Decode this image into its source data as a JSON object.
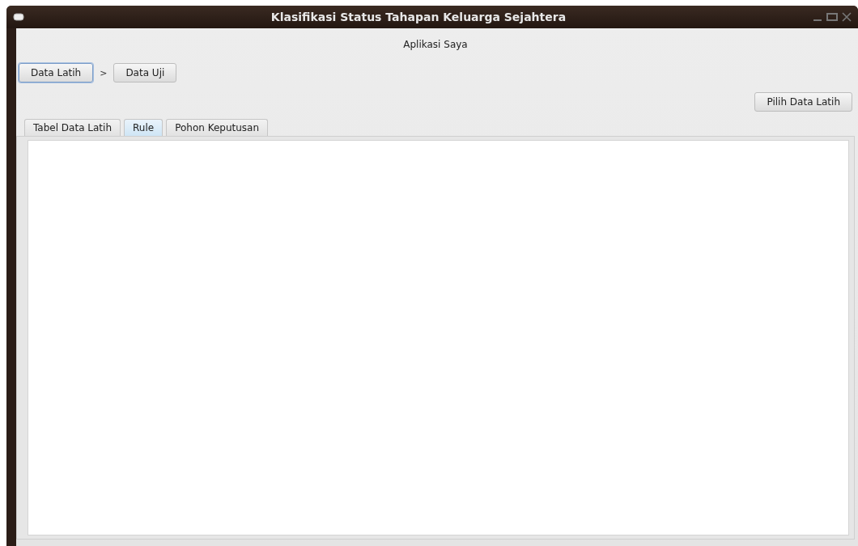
{
  "window": {
    "title": "Klasifikasi Status Tahapan Keluarga Sejahtera"
  },
  "header": "Aplikasi Saya",
  "steps": [
    {
      "label": "Data Latih",
      "focused": true
    },
    {
      "label": "Data Uji",
      "focused": false
    }
  ],
  "step_separator": ">",
  "action_button": "Pilih Data Latih",
  "tabs": [
    {
      "label": "Tabel Data Latih",
      "selected": false
    },
    {
      "label": "Rule",
      "selected": true
    },
    {
      "label": "Pohon Keputusan",
      "selected": false
    }
  ]
}
